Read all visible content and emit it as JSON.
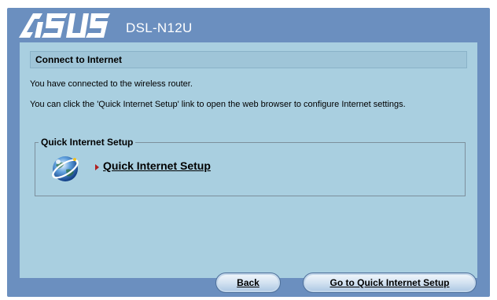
{
  "header": {
    "logo_text": "ASUS",
    "model": "DSL-N12U"
  },
  "section": {
    "title": "Connect to Internet",
    "line1": "You have connected to the wireless router.",
    "line2": "You can click the 'Quick Internet Setup' link to open the web browser to configure Internet settings."
  },
  "quick_setup": {
    "legend": "Quick Internet Setup",
    "link_label": "Quick Internet Setup",
    "icon": "globe-icon"
  },
  "buttons": {
    "back": "Back",
    "go": "Go to Quick Internet Setup"
  },
  "colors": {
    "frame": "#6b8fbf",
    "panel": "#a9cfe0",
    "arrow": "#b02020"
  }
}
